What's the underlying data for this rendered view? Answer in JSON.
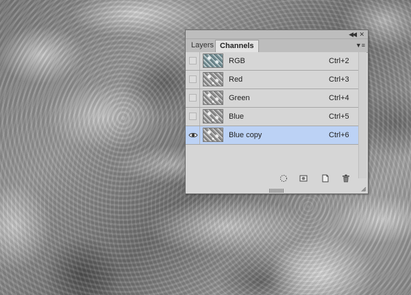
{
  "panel": {
    "tabs": [
      {
        "label": "Layers",
        "active": false
      },
      {
        "label": "Channels",
        "active": true
      }
    ]
  },
  "channels": [
    {
      "name": "RGB",
      "shortcut": "Ctrl+2",
      "visible": false,
      "selected": false,
      "thumb": "rgb"
    },
    {
      "name": "Red",
      "shortcut": "Ctrl+3",
      "visible": false,
      "selected": false,
      "thumb": "gray"
    },
    {
      "name": "Green",
      "shortcut": "Ctrl+4",
      "visible": false,
      "selected": false,
      "thumb": "gray"
    },
    {
      "name": "Blue",
      "shortcut": "Ctrl+5",
      "visible": false,
      "selected": false,
      "thumb": "gray"
    },
    {
      "name": "Blue copy",
      "shortcut": "Ctrl+6",
      "visible": true,
      "selected": true,
      "thumb": "gray"
    }
  ],
  "bottom_icons": [
    "load-selection-icon",
    "save-selection-icon",
    "new-channel-icon",
    "trash-icon"
  ],
  "colors": {
    "selected_row": "#bcd2f5",
    "panel_bg": "#d6d6d6"
  }
}
